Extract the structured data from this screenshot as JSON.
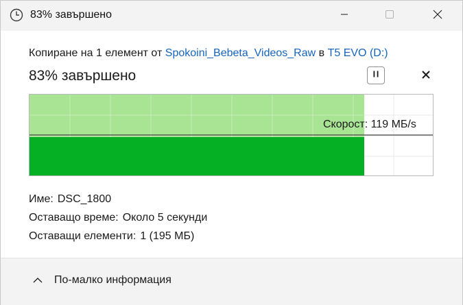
{
  "window": {
    "title": "83% завършено"
  },
  "copy": {
    "prefix": "Копиране на 1 елемент от",
    "source": "Spokoini_Bebeta_Videos_Raw",
    "joiner": "в",
    "destination": "T5 EVO (D:)"
  },
  "progress": {
    "label": "83% завършено",
    "percent": 83,
    "speed_label": "Скорост: 119 МБ/s"
  },
  "details": {
    "name_key": "Име:",
    "name_value": "DSC_1800",
    "time_key": "Оставащо време:",
    "time_value": "Около 5 секунди",
    "items_key": "Оставащи елементи:",
    "items_value": "1 (195 МБ)"
  },
  "footer": {
    "less_info_label": "По-малко информация"
  },
  "colors": {
    "progress_fill": "#06b025",
    "progress_light": "#a9e394",
    "link": "#1565c0"
  },
  "icons": {
    "title": "clock-icon",
    "minimize": "minimize-icon",
    "maximize": "maximize-icon",
    "close": "close-icon",
    "pause": "pause-icon",
    "cancel": "close-icon",
    "chevron": "chevron-up-icon"
  }
}
